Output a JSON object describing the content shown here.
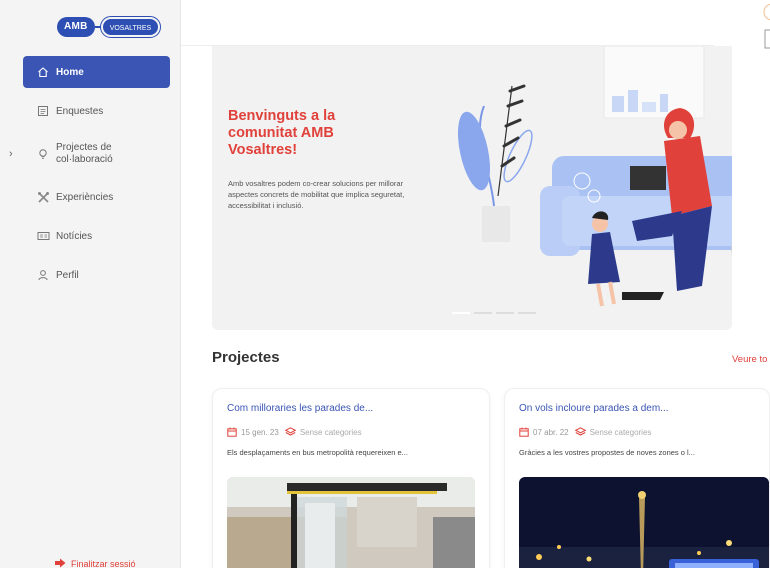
{
  "brand": {
    "amb": "AMB",
    "vosaltres": "VOSALTRES"
  },
  "nav": {
    "items": [
      {
        "label": "Home",
        "icon": "home-icon"
      },
      {
        "label": "Enquestes",
        "icon": "survey-icon"
      },
      {
        "label": "Projectes de col·laboració",
        "icon": "lightbulb-icon"
      },
      {
        "label": "Experiències",
        "icon": "tools-icon"
      },
      {
        "label": "Notícies",
        "icon": "news-icon"
      },
      {
        "label": "Perfil",
        "icon": "user-icon"
      }
    ],
    "logout": "Finalitzar sessió"
  },
  "hero": {
    "title": "Benvinguts a la comunitat AMB Vosaltres!",
    "text": "Amb vosaltres podem co-crear solucions per millorar aspectes concrets de mobilitat que implica seguretat, accessibilitat i inclusió."
  },
  "projects": {
    "title": "Projectes",
    "see_all": "Veure to",
    "cards": [
      {
        "title": "Com milloraries les parades de...",
        "date": "15 gen. 23",
        "category": "Sense categories",
        "desc": "Els desplaçaments en bus metropolità requereixen e..."
      },
      {
        "title": "On vols incloure parades a dem...",
        "date": "07 abr. 22",
        "category": "Sense categories",
        "desc": "Gràcies a les vostres propostes de noves zones o l..."
      }
    ]
  },
  "colors": {
    "primary": "#3a55b4",
    "accent": "#e0413a"
  }
}
